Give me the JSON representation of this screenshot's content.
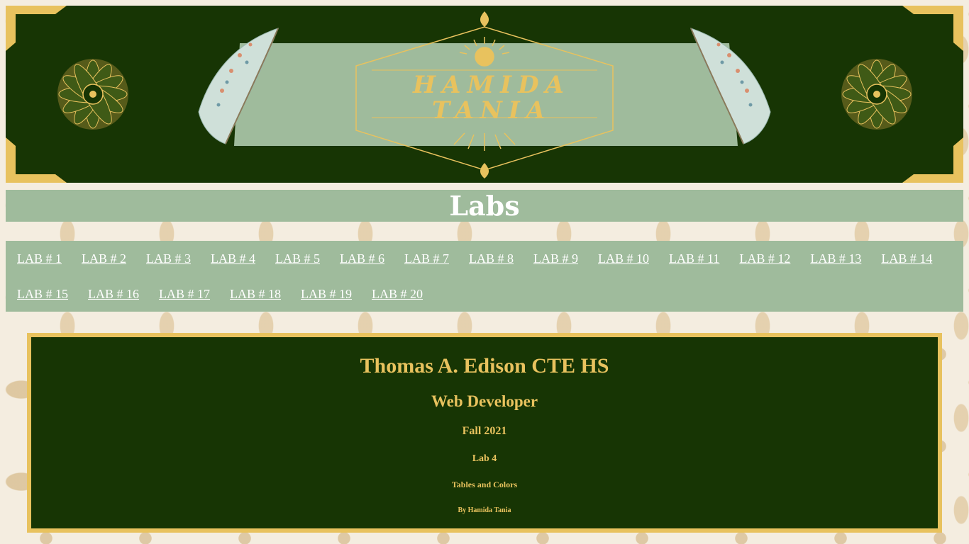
{
  "banner": {
    "title_line1": "HAMIDA",
    "title_line2": "TANIA",
    "colors": {
      "background": "#173504",
      "gold": "#e8c25e",
      "ribbon": "#9fbb9c"
    },
    "icons": [
      "mandala-icon",
      "feather-icon",
      "sun-icon",
      "fleur-icon"
    ]
  },
  "labs_heading": "Labs",
  "nav": {
    "links": [
      "LAB # 1",
      "LAB # 2",
      "LAB # 3",
      "LAB # 4",
      "LAB # 5",
      "LAB # 6",
      "LAB # 7",
      "LAB # 8",
      "LAB # 9",
      "LAB # 10",
      "LAB # 11",
      "LAB # 12",
      "LAB # 13",
      "LAB # 14",
      "LAB # 15",
      "LAB # 16",
      "LAB # 17",
      "LAB # 18",
      "LAB # 19",
      "LAB # 20"
    ]
  },
  "info": {
    "school": "Thomas A. Edison CTE HS",
    "course": "Web Developer",
    "term": "Fall 2021",
    "lab": "Lab 4",
    "topic": "Tables and Colors",
    "author": "By Hamida Tania"
  }
}
